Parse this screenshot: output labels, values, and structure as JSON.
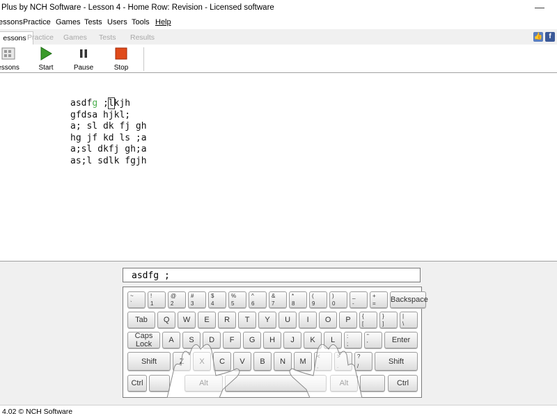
{
  "window": {
    "title": "Plus by NCH Software - Lesson 4 - Home Row: Revision - Licensed software",
    "minimize_glyph": "—"
  },
  "menu": [
    "essons",
    "Practice",
    "Games",
    "Tests",
    "Users",
    "Tools",
    "Help"
  ],
  "tabs": [
    "essons",
    "Practice",
    "Games",
    "Tests",
    "Results"
  ],
  "social": {
    "like": "👍",
    "facebook": "f"
  },
  "toolbar": {
    "lessons": "essons",
    "start": "Start",
    "pause": "Pause",
    "stop": "Stop"
  },
  "colors": {
    "start": "#3a9a2a",
    "stop": "#e04a1a",
    "typed": "#4caf50"
  },
  "lesson": {
    "line1": {
      "typed": "asdf",
      "next": "g",
      "mid": " ;",
      "cursor": "l",
      "rest": "kjh"
    },
    "lines": [
      "gfdsa hjkl;",
      "a; sl dk fj gh",
      "hg jf kd ls ;a",
      "a;sl dkfj gh;a",
      "as;l sdlk fgjh"
    ]
  },
  "input": {
    "value": "asdfg ;"
  },
  "keyboard": {
    "row1": [
      [
        "~",
        "`"
      ],
      [
        "!",
        "1"
      ],
      [
        "@",
        "2"
      ],
      [
        "#",
        "3"
      ],
      [
        "$",
        "4"
      ],
      [
        "%",
        "5"
      ],
      [
        "^",
        "6"
      ],
      [
        "&",
        "7"
      ],
      [
        "*",
        "8"
      ],
      [
        "(",
        "9"
      ],
      [
        ")",
        "0"
      ],
      [
        "_",
        "-"
      ],
      [
        "+",
        "="
      ]
    ],
    "backspace": "Backspace",
    "tab": "Tab",
    "row2": [
      "Q",
      "W",
      "E",
      "R",
      "T",
      "Y",
      "U",
      "I",
      "O",
      "P"
    ],
    "row2_extra": [
      [
        "{",
        "["
      ],
      [
        "}",
        "]"
      ],
      [
        "|",
        "\\"
      ]
    ],
    "caps": "Caps Lock",
    "row3": [
      "A",
      "S",
      "D",
      "F",
      "G",
      "H",
      "J",
      "K",
      "L"
    ],
    "row3_extra": [
      [
        ":",
        ";"
      ],
      [
        "\"",
        "'"
      ]
    ],
    "enter": "Enter",
    "shift_left": "Shift",
    "row4": [
      "Z",
      "X",
      "C",
      "V",
      "B",
      "N",
      "M"
    ],
    "row4_extra": [
      [
        "<",
        ","
      ],
      [
        ">",
        "."
      ],
      [
        "?",
        "/"
      ]
    ],
    "shift_right": "Shift",
    "ctrl": "Ctrl",
    "alt": "Alt"
  },
  "status": {
    "text": "4.02 © NCH Software"
  }
}
